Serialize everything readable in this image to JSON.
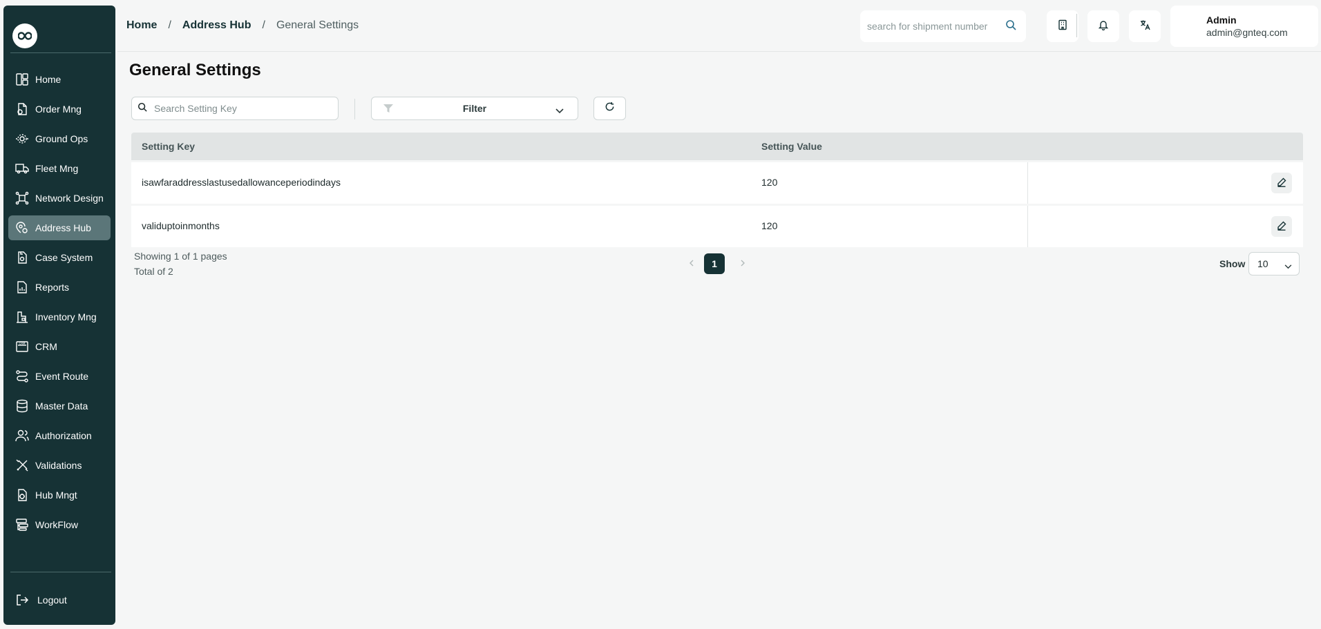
{
  "sidebar": {
    "logo_icon": "infinity-icon",
    "items": [
      {
        "label": "Home",
        "icon": "home-icon"
      },
      {
        "label": "Order Mng",
        "icon": "order-icon"
      },
      {
        "label": "Ground Ops",
        "icon": "ground-ops-icon"
      },
      {
        "label": "Fleet Mng",
        "icon": "truck-icon"
      },
      {
        "label": "Network Design",
        "icon": "network-icon"
      },
      {
        "label": "Address Hub",
        "icon": "address-icon",
        "active": true
      },
      {
        "label": "Case System",
        "icon": "case-icon"
      },
      {
        "label": "Reports",
        "icon": "reports-icon"
      },
      {
        "label": "Inventory Mng",
        "icon": "inventory-icon"
      },
      {
        "label": "CRM",
        "icon": "crm-icon"
      },
      {
        "label": "Event Route",
        "icon": "route-icon"
      },
      {
        "label": "Master Data",
        "icon": "database-icon"
      },
      {
        "label": "Authorization",
        "icon": "users-icon"
      },
      {
        "label": "Validations",
        "icon": "validations-icon"
      },
      {
        "label": "Hub Mngt",
        "icon": "hub-icon"
      },
      {
        "label": "WorkFlow",
        "icon": "workflow-icon"
      }
    ],
    "logout_label": "Logout"
  },
  "header": {
    "breadcrumb": [
      "Home",
      "Address Hub",
      "General Settings"
    ],
    "breadcrumb_sep": "/",
    "search_placeholder": "search for shipment number",
    "user": {
      "name": "Admin",
      "email": "admin@gnteq.com"
    }
  },
  "page": {
    "title": "General Settings",
    "search_placeholder": "Search Setting Key",
    "filter_label": "Filter"
  },
  "table": {
    "columns": [
      "Setting Key",
      "Setting Value"
    ],
    "rows": [
      {
        "key": "isawfaraddresslastusedallowanceperiodindays",
        "value": "120"
      },
      {
        "key": "validuptoinmonths",
        "value": "120"
      }
    ]
  },
  "pagination": {
    "showing": "Showing 1 of 1 pages",
    "total": "Total of 2",
    "current_page": "1",
    "show_label": "Show",
    "page_size": "10"
  },
  "colors": {
    "sidebar_bg": "#163235",
    "active_item": "#5b7679",
    "accent": "#163235"
  }
}
